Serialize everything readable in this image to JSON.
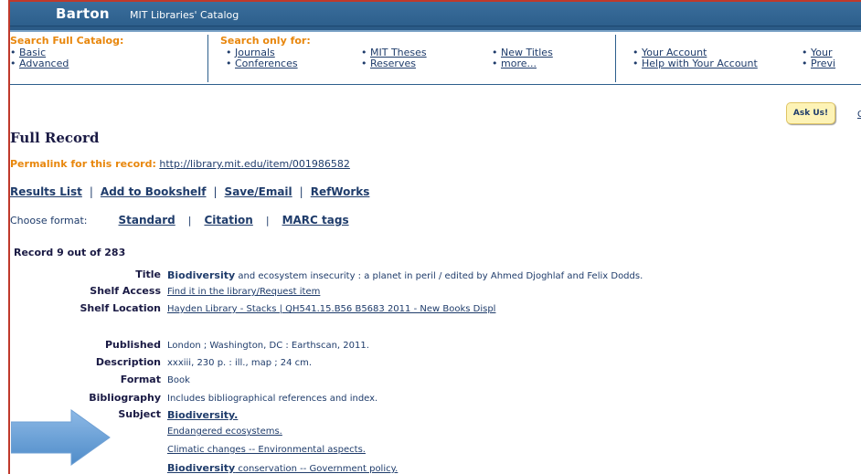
{
  "header": {
    "brand": "Barton",
    "subtitle": "MIT Libraries' Catalog"
  },
  "nav": {
    "full_catalog_heading": "Search Full Catalog:",
    "full_catalog_items": [
      "Basic",
      "Advanced"
    ],
    "only_for_heading": "Search only for:",
    "only_for_col1": [
      "Journals",
      "Conferences"
    ],
    "only_for_col2": [
      "MIT Theses",
      "Reserves"
    ],
    "only_for_col3": [
      "New Titles",
      "more..."
    ],
    "account_items": [
      "Your Account",
      "Help with Your Account"
    ],
    "edge_items": [
      "Your",
      "Previ"
    ]
  },
  "askus": {
    "label": "Ask Us!"
  },
  "edge_letter": "G",
  "page": {
    "title": "Full Record",
    "permalink_label": "Permalink for this record:",
    "permalink_url": "http://library.mit.edu/item/001986582"
  },
  "actions": {
    "results": "Results List",
    "bookshelf": "Add to Bookshelf",
    "save": "Save/Email",
    "refworks": "RefWorks",
    "separator": "|"
  },
  "format": {
    "label": "Choose format:",
    "standard": "Standard",
    "citation": "Citation",
    "marc": "MARC tags",
    "separator": "|"
  },
  "record": {
    "count": "Record 9 out of 283",
    "title_label": "Title",
    "title_bold": "Biodiversity",
    "title_rest": " and ecosystem insecurity : a planet in peril / edited by Ahmed Djoghlaf and Felix Dodds.",
    "shelf_access_label": "Shelf Access",
    "shelf_access_value": "Find it in the library/Request item",
    "shelf_location_label": "Shelf Location",
    "shelf_location_value": "Hayden Library - Stacks | QH541.15.B56 B5683 2011 - New Books Displ",
    "published_label": "Published",
    "published_value": "London ; Washington, DC : Earthscan, 2011.",
    "description_label": "Description",
    "description_value": "xxxiii, 230 p. : ill., map ; 24 cm.",
    "format_label": "Format",
    "format_value": "Book",
    "bibliography_label": "Bibliography",
    "bibliography_value": "Includes bibliographical references and index.",
    "subject_label": "Subject",
    "subject_1": "Biodiversity.",
    "subject_2": "Endangered ecosystems.",
    "subject_3": "Climatic changes -- Environmental aspects.",
    "subject_4_bold": "Biodiversity",
    "subject_4_rest": " conservation -- Government policy."
  },
  "colors": {
    "header_blue": "#2d5f8c",
    "orange": "#e8870d",
    "link": "#1f3c6b",
    "arrow": "#5b9bd5"
  }
}
